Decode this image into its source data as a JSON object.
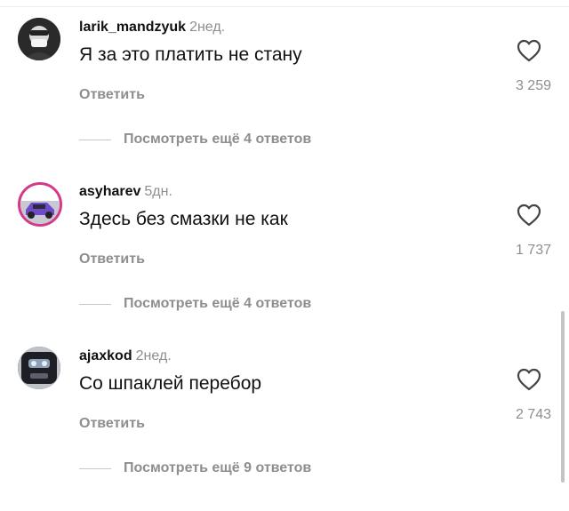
{
  "comments": [
    {
      "username": "larik_mandzyuk",
      "time": "2нед.",
      "text": "Я за это платить не стану",
      "reply_label": "Ответить",
      "likes": "3 259",
      "more_label": "Посмотреть ещё 4 ответов",
      "avatar_icon": "masked-person-avatar"
    },
    {
      "username": "asyharev",
      "time": "5дн.",
      "text": "Здесь без смазки не как",
      "reply_label": "Ответить",
      "likes": "1 737",
      "more_label": "Посмотреть ещё 4 ответов",
      "avatar_icon": "car-avatar"
    },
    {
      "username": "ajaxkod",
      "time": "2нед.",
      "text": "Со шпаклей перебор",
      "reply_label": "Ответить",
      "likes": "2 743",
      "more_label": "Посмотреть ещё 9 ответов",
      "avatar_icon": "robot-avatar"
    }
  ],
  "colors": {
    "text": "#111111",
    "muted": "#8e8e8e",
    "story_ring": "#d63a86"
  }
}
